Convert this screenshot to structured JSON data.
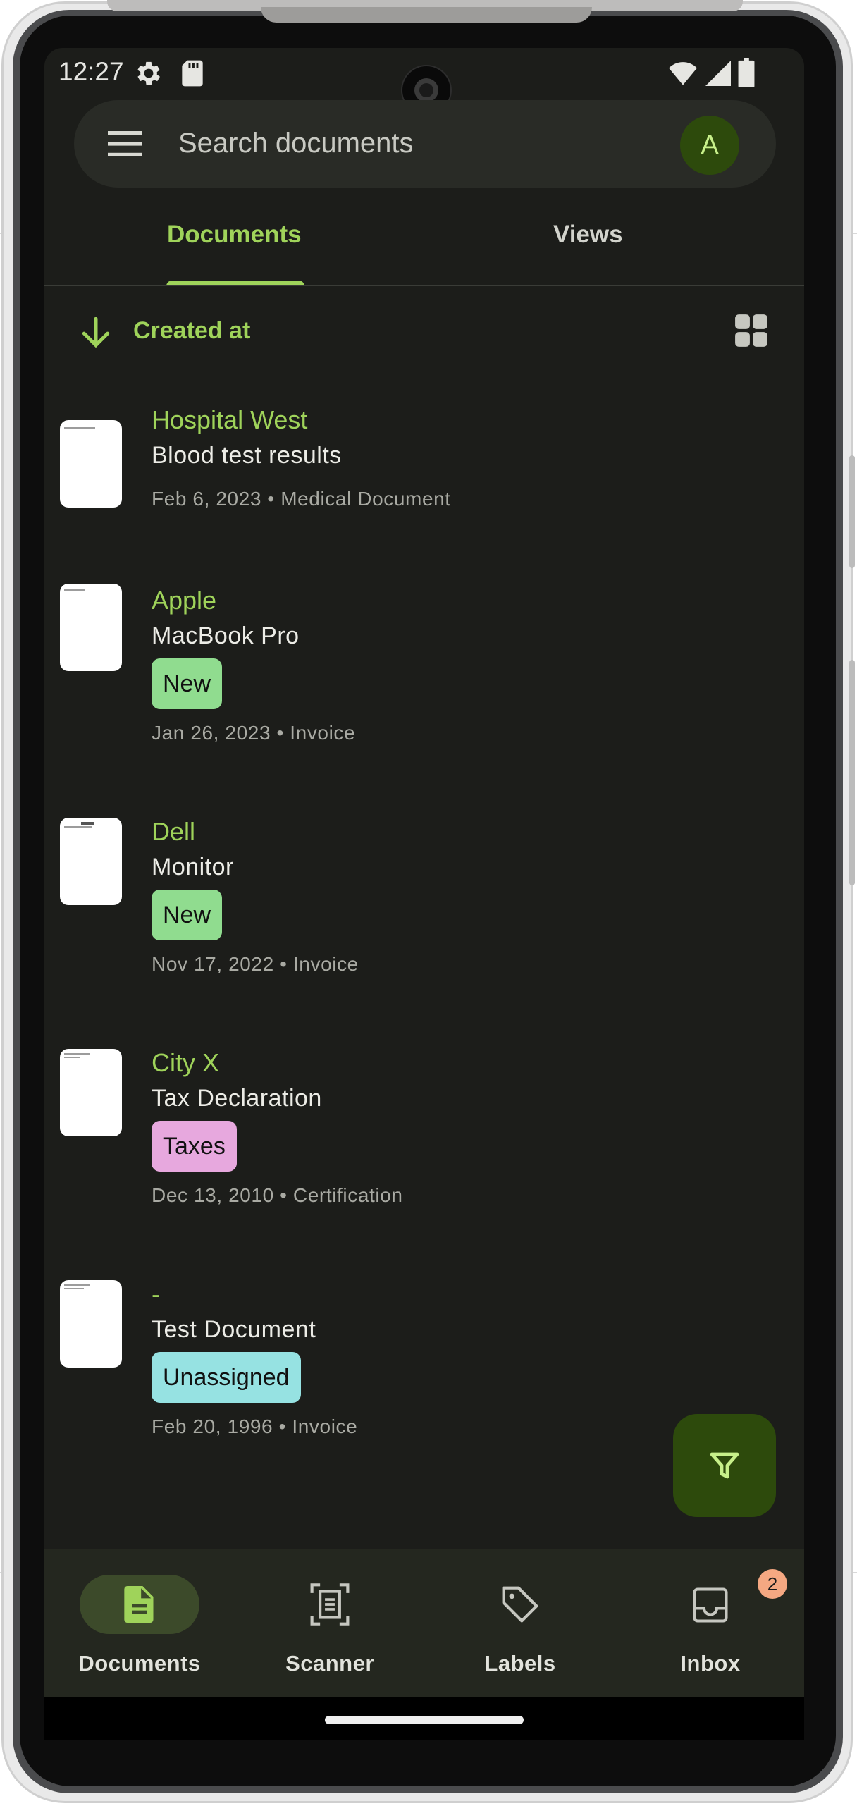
{
  "status_bar": {
    "time": "12:27"
  },
  "search": {
    "placeholder": "Search documents",
    "avatar_initial": "A"
  },
  "tabs": [
    {
      "label": "Documents",
      "active": true
    },
    {
      "label": "Views",
      "active": false
    }
  ],
  "sort": {
    "label": "Created at",
    "direction": "descending"
  },
  "documents": [
    {
      "correspondent": "Hospital West",
      "title": "Blood test results",
      "tag": null,
      "meta": "Feb 6, 2023 • Medical Document"
    },
    {
      "correspondent": "Apple",
      "title": "MacBook Pro",
      "tag": "New",
      "meta": "Jan 26, 2023 • Invoice"
    },
    {
      "correspondent": "Dell",
      "title": "Monitor",
      "tag": "New",
      "meta": "Nov 17, 2022 • Invoice"
    },
    {
      "correspondent": "City X",
      "title": "Tax Declaration",
      "tag": "Taxes",
      "meta": "Dec 13, 2010 • Certification"
    },
    {
      "correspondent": "-",
      "title": "Test Document",
      "tag": "Unassigned",
      "meta": "Feb 20, 1996 • Invoice"
    }
  ],
  "tag_colors": {
    "New": "#90dc8f",
    "Taxes": "#e7a8de",
    "Unassigned": "#96e2e2"
  },
  "bottom_nav": [
    {
      "label": "Documents",
      "icon": "document-icon",
      "active": true
    },
    {
      "label": "Scanner",
      "icon": "scanner-icon",
      "active": false
    },
    {
      "label": "Labels",
      "icon": "label-icon",
      "active": false
    },
    {
      "label": "Inbox",
      "icon": "inbox-icon",
      "active": false,
      "badge": "2"
    }
  ],
  "colors": {
    "accent": "#9fd35a",
    "background": "#1c1d1a",
    "fab": "#2d4a0c"
  }
}
